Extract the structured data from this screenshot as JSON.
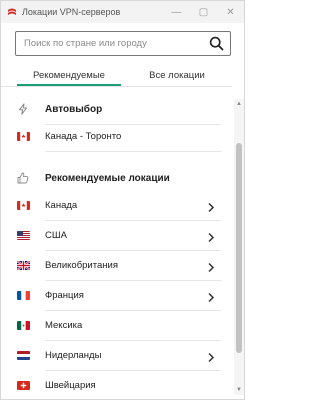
{
  "window": {
    "title": "Локации VPN-серверов",
    "controls": {
      "minimize": "—",
      "maximize": "▢",
      "close": "✕"
    }
  },
  "search": {
    "placeholder": "Поиск по стране или городу",
    "value": ""
  },
  "tabs": [
    {
      "label": "Рекомендуемые",
      "active": true
    },
    {
      "label": "Все локации",
      "active": false
    }
  ],
  "autoselect": {
    "label": "Автовыбор",
    "icon": "lightning-icon"
  },
  "current_location": {
    "label": "Канада - Торонто",
    "flag": "canada-flag"
  },
  "recommended": {
    "heading": "Рекомендуемые локации",
    "icon": "thumbs-up-icon",
    "items": [
      {
        "label": "Канада",
        "flag": "canada-flag",
        "has_chevron": true
      },
      {
        "label": "США",
        "flag": "usa-flag",
        "has_chevron": true
      },
      {
        "label": "Великобритания",
        "flag": "uk-flag",
        "has_chevron": true
      },
      {
        "label": "Франция",
        "flag": "france-flag",
        "has_chevron": true
      },
      {
        "label": "Мексика",
        "flag": "mexico-flag",
        "has_chevron": false
      },
      {
        "label": "Нидерланды",
        "flag": "netherlands-flag",
        "has_chevron": true
      },
      {
        "label": "Швейцария",
        "flag": "switzerland-flag",
        "has_chevron": false
      }
    ]
  },
  "colors": {
    "accent": "#1a9e7a",
    "brand_red": "#d62b2b"
  }
}
